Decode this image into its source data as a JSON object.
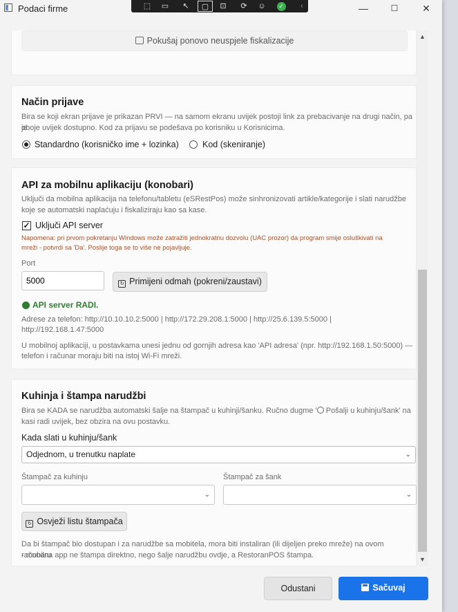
{
  "window": {
    "title": "Podaci firme",
    "minimize": "—",
    "maximize": "☐",
    "close": "✕"
  },
  "toolbar_icons": [
    "capture-icon",
    "video-icon",
    "pointer-icon",
    "select-icon",
    "screen-icon",
    "accessibility-icon",
    "person-icon",
    "check-icon",
    "chevron-left-icon"
  ],
  "retry": {
    "label": "Pokušaj ponovo neuspjele fiskalizacije"
  },
  "login": {
    "title": "Način prijave",
    "desc1": "Bira se koji ekran prijave je prikazan PRVI — na samom ekranu uvijek postoji link za prebacivanje na drugi način, pa je",
    "desc2": "oboje uvijek dostupno. Kod za prijavu se podešava po korisniku u Korisnicima.",
    "option_standard": "Standardno (korisničko ime + lozinka)",
    "option_code": "Kod (skeniranje)",
    "selected": "standard"
  },
  "api": {
    "title": "API za mobilnu aplikaciju (konobari)",
    "desc1": "Uključi da mobilna aplikacija na telefonu/tabletu (eSRestPos) može sinhronizovati artikle/kategorije i slati narudžbe",
    "desc2": "koje se automatski naplaćuju i fiskaliziraju kao sa kase.",
    "enable_label": "Uključi API server",
    "enabled": true,
    "note1": "Napomena: pri prvom pokretanju Windows može zatražiti jednokratnu dozvolu (UAC prozor) da program smije osluškivati na",
    "note2": "mreži - potvrdi sa 'Da'. Poslije toga se to više ne pojavljuje.",
    "port_label": "Port",
    "port_value": "5000",
    "apply_label": "Primijeni odmah (pokreni/zaustavi)",
    "status": "API server RADI.",
    "status_color": "#2e7d32",
    "addresses1": "Adrese za telefon: http://10.10.10.2:5000   |   http://172.29.208.1:5000   |   http://25.6.139.5:5000   |",
    "addresses2": "http://192.168.1.47:5000",
    "help1": "U mobilnoj aplikaciji, u postavkama unesi jednu od gornjih adresa kao 'API adresa' (npr. http://192.168.1.50:5000) —",
    "help2": "telefon i računar moraju biti na istoj Wi-Fi mreži."
  },
  "kitchen": {
    "title": "Kuhinja i štampa narudžbi",
    "desc1a": "Bira se KADA se narudžba automatski šalje na štampač u kuhinji/šanku. Ručno dugme '",
    "desc1b": " Pošalji u kuhinju/šank' na",
    "desc2": "kasi radi uvijek, bez obzira na ovu postavku.",
    "when_label": "Kada slati u kuhinju/šank",
    "when_value": "Odjednom, u trenutku naplate",
    "kitchen_printer_label": "Štampač za kuhinju",
    "kitchen_printer_value": "",
    "bar_printer_label": "Štampač za šank",
    "bar_printer_value": "",
    "refresh_label": "Osvježi listu štampača",
    "info1": "Da bi štampač bio dostupan i za narudžbe sa mobitela, mora biti instaliran (ili dijeljen preko mreže) na ovom računaru",
    "info2": "- mobilna app ne štampa direktno, nego šalje narudžbu ovdje, a RestoranPOS štampa."
  },
  "footer": {
    "cancel_label": "Odustani",
    "save_label": "Sačuvaj",
    "accent": "#1a73e8"
  }
}
